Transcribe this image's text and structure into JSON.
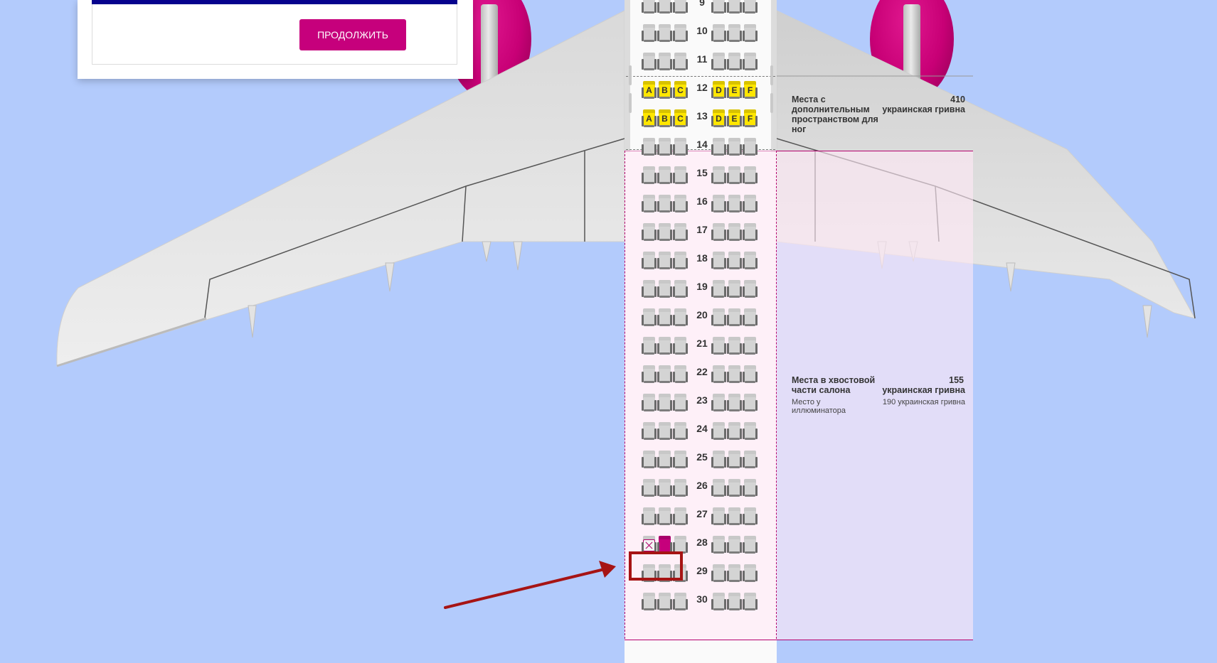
{
  "popup": {
    "continue_label": "ПРОДОЛЖИТЬ"
  },
  "cabin": {
    "rows": [
      {
        "num": "9",
        "seats": [
          "o",
          "o",
          "o",
          "o",
          "o",
          "o"
        ]
      },
      {
        "num": "10",
        "seats": [
          "o",
          "o",
          "o",
          "o",
          "o",
          "o"
        ]
      },
      {
        "num": "11",
        "seats": [
          "o",
          "o",
          "o",
          "o",
          "o",
          "o"
        ]
      },
      {
        "num": "12",
        "seats": [
          "A",
          "B",
          "C",
          "D",
          "E",
          "F"
        ]
      },
      {
        "num": "13",
        "seats": [
          "A",
          "B",
          "C",
          "D",
          "E",
          "F"
        ]
      },
      {
        "num": "14",
        "seats": [
          "o",
          "o",
          "o",
          "o",
          "o",
          "o"
        ]
      },
      {
        "num": "15",
        "seats": [
          "o",
          "o",
          "o",
          "o",
          "o",
          "o"
        ]
      },
      {
        "num": "16",
        "seats": [
          "o",
          "o",
          "o",
          "o",
          "o",
          "o"
        ]
      },
      {
        "num": "17",
        "seats": [
          "o",
          "o",
          "o",
          "o",
          "o",
          "o"
        ]
      },
      {
        "num": "18",
        "seats": [
          "o",
          "o",
          "o",
          "o",
          "o",
          "o"
        ]
      },
      {
        "num": "19",
        "seats": [
          "o",
          "o",
          "o",
          "o",
          "o",
          "o"
        ]
      },
      {
        "num": "20",
        "seats": [
          "o",
          "o",
          "o",
          "o",
          "o",
          "o"
        ]
      },
      {
        "num": "21",
        "seats": [
          "o",
          "o",
          "o",
          "o",
          "o",
          "o"
        ]
      },
      {
        "num": "22",
        "seats": [
          "o",
          "o",
          "o",
          "o",
          "o",
          "o"
        ]
      },
      {
        "num": "23",
        "seats": [
          "o",
          "o",
          "o",
          "o",
          "o",
          "o"
        ]
      },
      {
        "num": "24",
        "seats": [
          "o",
          "o",
          "o",
          "o",
          "o",
          "o"
        ]
      },
      {
        "num": "25",
        "seats": [
          "o",
          "o",
          "o",
          "o",
          "o",
          "o"
        ]
      },
      {
        "num": "26",
        "seats": [
          "o",
          "o",
          "o",
          "o",
          "o",
          "o"
        ]
      },
      {
        "num": "27",
        "seats": [
          "o",
          "o",
          "o",
          "o",
          "o",
          "o"
        ]
      },
      {
        "num": "28",
        "seats": [
          "x",
          "s",
          "o",
          "o",
          "o",
          "o"
        ]
      },
      {
        "num": "29",
        "seats": [
          "o",
          "o",
          "o",
          "o",
          "o",
          "o"
        ]
      },
      {
        "num": "30",
        "seats": [
          "o",
          "o",
          "o",
          "o",
          "o",
          "o"
        ]
      }
    ],
    "seat_states": {
      "o": "occupied",
      "x": "blocked",
      "s": "selected"
    }
  },
  "legend": {
    "extra_legroom": {
      "title": "Места с дополнительным пространством для ног",
      "price": "410",
      "currency": "украинская гривна"
    },
    "tail": {
      "title": "Места в хвостовой части салона",
      "price": "155",
      "currency": "украинская гривна",
      "window_label": "Место у иллюминатора",
      "window_price": "190 украинская гривна"
    }
  },
  "colors": {
    "sky": "#b3cbfc",
    "brand": "#c6007c",
    "available_seat": "#ffe600",
    "header_bar": "#06038d",
    "highlight": "#a61414"
  }
}
